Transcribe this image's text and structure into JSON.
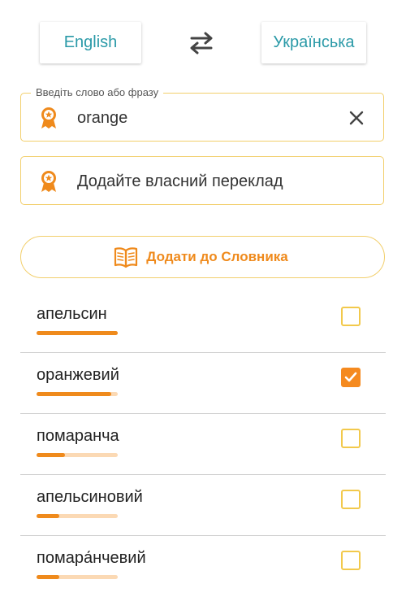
{
  "language_bar": {
    "from_label": "English",
    "to_label": "Українська"
  },
  "input": {
    "legend": "Введіть слово або фразу",
    "value": "orange"
  },
  "own_translation": {
    "label": "Додайте власний переклад"
  },
  "dictionary_button": {
    "label": "Додати до Словника"
  },
  "translations": [
    {
      "word": "апельсин",
      "score": 1.0,
      "checked": false
    },
    {
      "word": "оранжевий",
      "score": 0.92,
      "checked": true
    },
    {
      "word": "помаранча",
      "score": 0.35,
      "checked": false
    },
    {
      "word": "апельсиновий",
      "score": 0.28,
      "checked": false
    },
    {
      "word": "помара́нчевий",
      "score": 0.28,
      "checked": false
    }
  ],
  "colors": {
    "accent_orange": "#ef8a1c",
    "teal_text": "#2b9aa8",
    "field_border": "#f2cf6c",
    "bar_track": "#fbd9b4"
  }
}
